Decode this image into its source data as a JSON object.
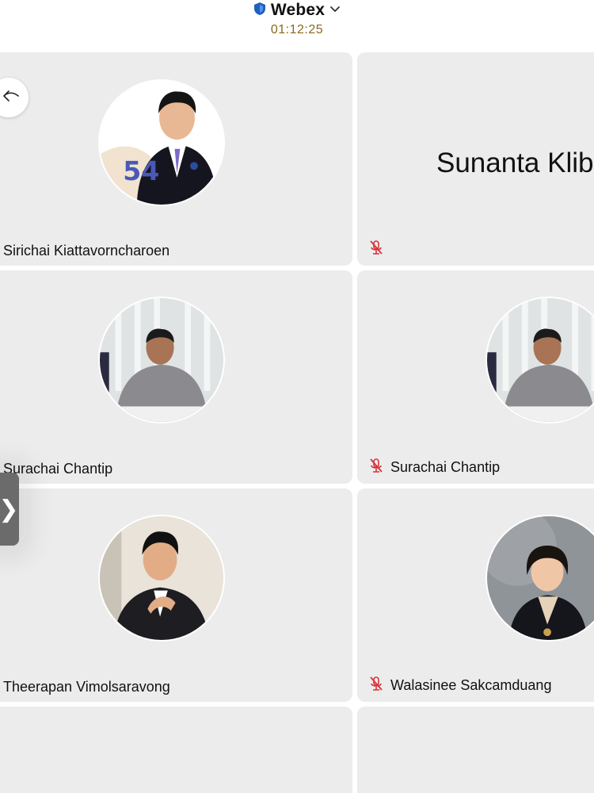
{
  "header": {
    "app_title": "Webex",
    "timer": "01:12:25"
  },
  "colors": {
    "tile_bg": "#ececec",
    "signal_green": "#2e9e62",
    "record_red": "#e02a35",
    "shield_blue": "#1f5fbf",
    "muted_red": "#d6333a",
    "timer_gold": "#8a6a1a"
  },
  "icons": {
    "security": "shield-icon",
    "dropdown": "chevron-down-icon",
    "signal": "signal-bars-icon",
    "recording": "record-icon",
    "back": "back-arrow-icon",
    "mute": "mic-muted-icon",
    "panel_toggle": "chevron-right-icon"
  },
  "participants": [
    {
      "name": "Sirichai Kiattavorncharoen",
      "muted": false,
      "avatar": "photo"
    },
    {
      "name": "Sunanta Klibt",
      "muted": true,
      "avatar": "name-text"
    },
    {
      "name": "Surachai Chantip",
      "muted": false,
      "avatar": "photo"
    },
    {
      "name": "Surachai Chantip",
      "muted": true,
      "avatar": "photo"
    },
    {
      "name": "Theerapan Vimolsaravong",
      "muted": false,
      "avatar": "photo"
    },
    {
      "name": "Walasinee Sakcamduang",
      "muted": true,
      "avatar": "photo"
    }
  ]
}
